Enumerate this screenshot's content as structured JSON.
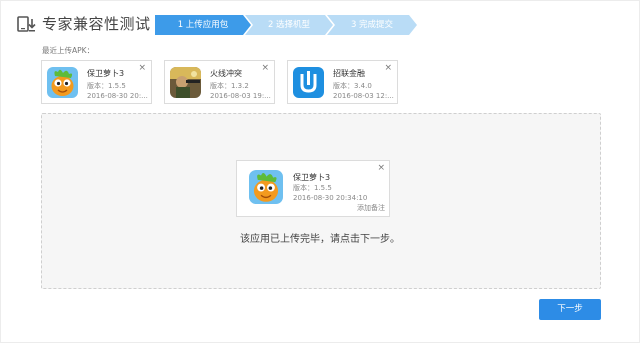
{
  "header": {
    "title": "专家兼容性测试",
    "steps": [
      {
        "label": "1 上传应用包",
        "active": true
      },
      {
        "label": "2 选择机型",
        "active": false
      },
      {
        "label": "3 完成提交",
        "active": false
      }
    ]
  },
  "recent": {
    "label": "最近上传APK：",
    "items": [
      {
        "name": "保卫萝卜3",
        "version": "版本：1.5.5",
        "date": "2016-08-30 20:...",
        "close": "×",
        "icon": "carrot-game-icon"
      },
      {
        "name": "火线冲突",
        "version": "版本：1.3.2",
        "date": "2016-08-03 19:...",
        "close": "×",
        "icon": "shooter-game-icon"
      },
      {
        "name": "招联金融",
        "version": "版本：3.4.0",
        "date": "2016-08-03 12:...",
        "close": "×",
        "icon": "finance-app-icon"
      }
    ]
  },
  "uploaded": {
    "name": "保卫萝卜3",
    "version": "版本：1.5.5",
    "date": "2016-08-30 20:34:10",
    "close": "×",
    "note": "添加备注",
    "message": "该应用已上传完毕，请点击下一步。"
  },
  "footer": {
    "next_label": "下一步"
  },
  "colors": {
    "accent": "#2d8ce6",
    "step_active": "#3d9be9",
    "step_inactive": "#b9dcf6"
  }
}
